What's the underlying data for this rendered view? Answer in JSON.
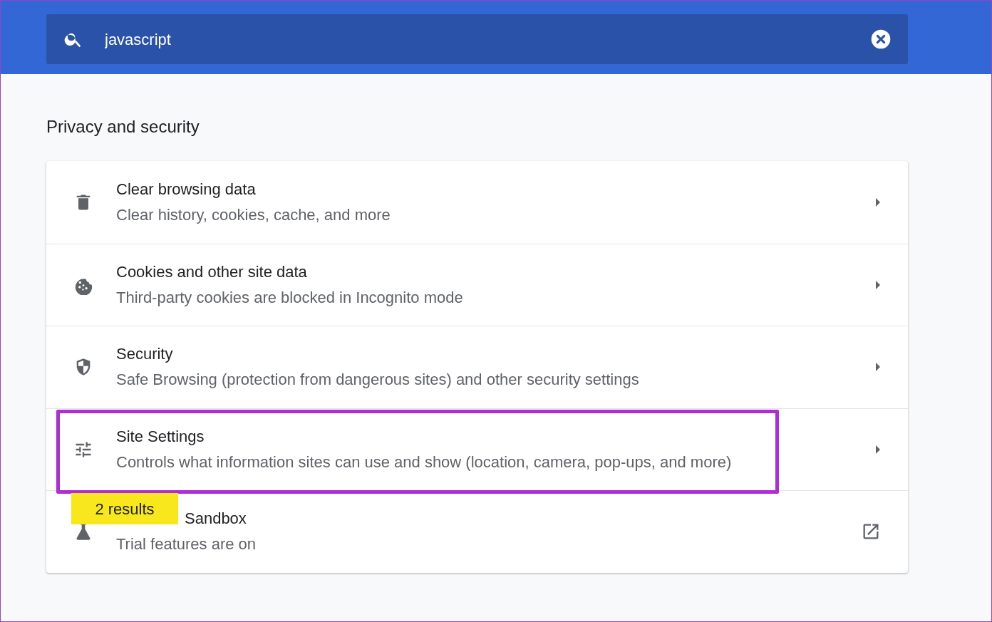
{
  "search": {
    "value": "javascript"
  },
  "section": {
    "title": "Privacy and security"
  },
  "rows": [
    {
      "kind": "trash",
      "title": "Clear browsing data",
      "subtitle": "Clear history, cookies, cache, and more",
      "action": {
        "kind": "arrow"
      },
      "highlighted": false
    },
    {
      "kind": "cookie",
      "title": "Cookies and other site data",
      "subtitle": "Third-party cookies are blocked in Incognito mode",
      "action": {
        "kind": "arrow"
      },
      "highlighted": false
    },
    {
      "kind": "shield",
      "title": "Security",
      "subtitle": "Safe Browsing (protection from dangerous sites) and other security settings",
      "action": {
        "kind": "arrow"
      },
      "highlighted": false
    },
    {
      "kind": "sliders",
      "title": "Site Settings",
      "subtitle": "Controls what information sites can use and show (location, camera, pop-ups, and more)",
      "action": {
        "kind": "arrow"
      },
      "highlighted": true
    },
    {
      "kind": "flask",
      "title": "Sandbox",
      "subtitle": "Trial features are on",
      "action": {
        "kind": "external"
      },
      "highlighted": false,
      "bubble": "2 results"
    }
  ]
}
